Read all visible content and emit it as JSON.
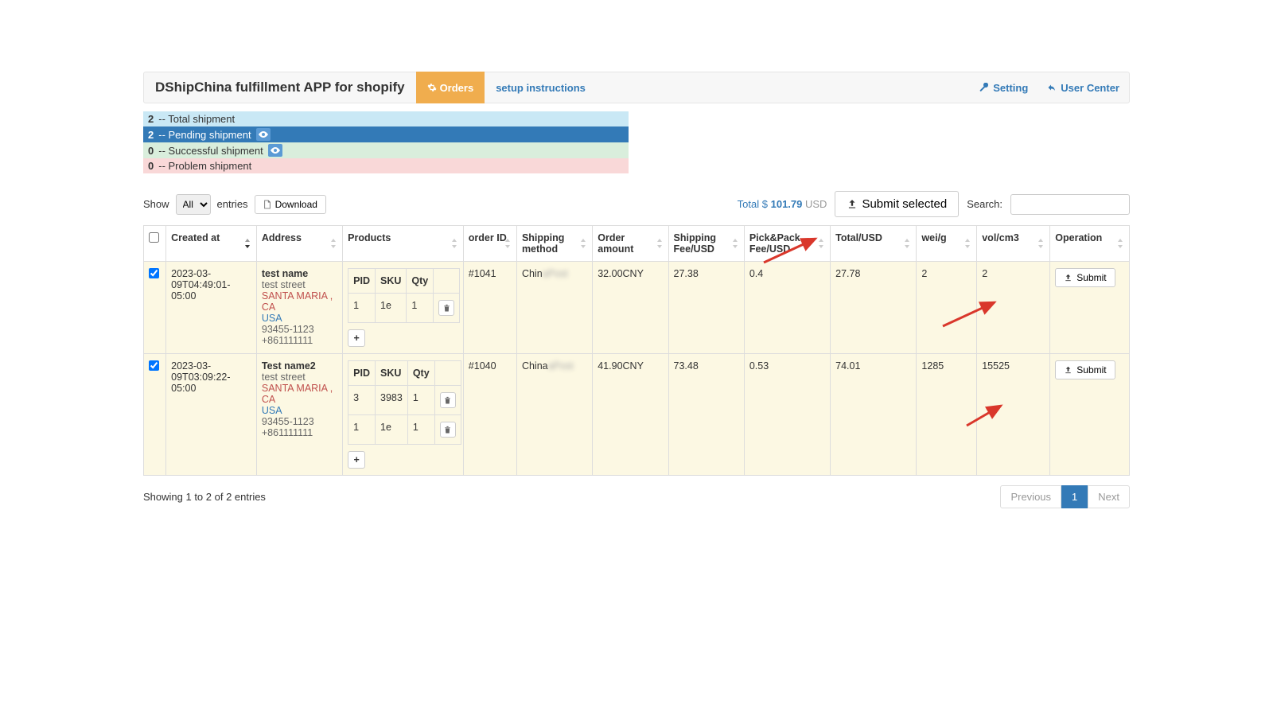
{
  "header": {
    "app_title": "DShipChina fulfillment APP for shopify",
    "tab_orders": "Orders",
    "tab_setup": "setup instructions",
    "link_setting": "Setting",
    "link_user_center": "User Center"
  },
  "status": {
    "total": {
      "count": "2",
      "label": "-- Total shipment"
    },
    "pending": {
      "count": "2",
      "label": "-- Pending shipment"
    },
    "success": {
      "count": "0",
      "label": "-- Successful shipment"
    },
    "problem": {
      "count": "0",
      "label": "-- Problem shipment"
    }
  },
  "toolbar": {
    "show_label": "Show",
    "show_value": "All",
    "entries_label": "entries",
    "download_label": "Download",
    "total_prefix": "Total $",
    "total_amount": "101.79",
    "total_currency": "USD",
    "submit_selected": "Submit selected",
    "search_label": "Search:"
  },
  "columns": {
    "checkbox": "",
    "created_at": "Created at",
    "address": "Address",
    "products": "Products",
    "order_id": "order ID",
    "shipping_method": "Shipping method",
    "order_amount": "Order amount",
    "shipping_fee": "Shipping Fee/USD",
    "pickpack_fee": "Pick&Pack Fee/USD",
    "total_usd": "Total/USD",
    "wei_g": "wei/g",
    "vol_cm3": "vol/cm3",
    "operation": "Operation"
  },
  "subcols": {
    "pid": "PID",
    "sku": "SKU",
    "qty": "Qty"
  },
  "rows": [
    {
      "checked": true,
      "created_at": "2023-03-09T04:49:01-05:00",
      "address": {
        "name": "test name",
        "street": "test street",
        "city": "SANTA MARIA , CA",
        "country": "USA",
        "zip": "93455-1123",
        "phone": "+861111111"
      },
      "products": [
        {
          "pid": "1",
          "sku": "1e",
          "qty": "1"
        }
      ],
      "order_id": "#1041",
      "shipping_method_prefix": "Chin",
      "order_amount": "32.00CNY",
      "shipping_fee": "27.38",
      "pickpack_fee": "0.4",
      "total_usd": "27.78",
      "wei_g": "2",
      "vol_cm3": "2",
      "submit_label": "Submit"
    },
    {
      "checked": true,
      "created_at": "2023-03-09T03:09:22-05:00",
      "address": {
        "name": "Test name2",
        "street": "test street",
        "city": "SANTA MARIA , CA",
        "country": "USA",
        "zip": "93455-1123",
        "phone": "+861111111"
      },
      "products": [
        {
          "pid": "3",
          "sku": "3983",
          "qty": "1"
        },
        {
          "pid": "1",
          "sku": "1e",
          "qty": "1"
        }
      ],
      "order_id": "#1040",
      "shipping_method_prefix": "China",
      "order_amount": "41.90CNY",
      "shipping_fee": "73.48",
      "pickpack_fee": "0.53",
      "total_usd": "74.01",
      "wei_g": "1285",
      "vol_cm3": "15525",
      "submit_label": "Submit"
    }
  ],
  "footer": {
    "info": "Showing 1 to 2 of 2 entries",
    "prev": "Previous",
    "page1": "1",
    "next": "Next"
  }
}
